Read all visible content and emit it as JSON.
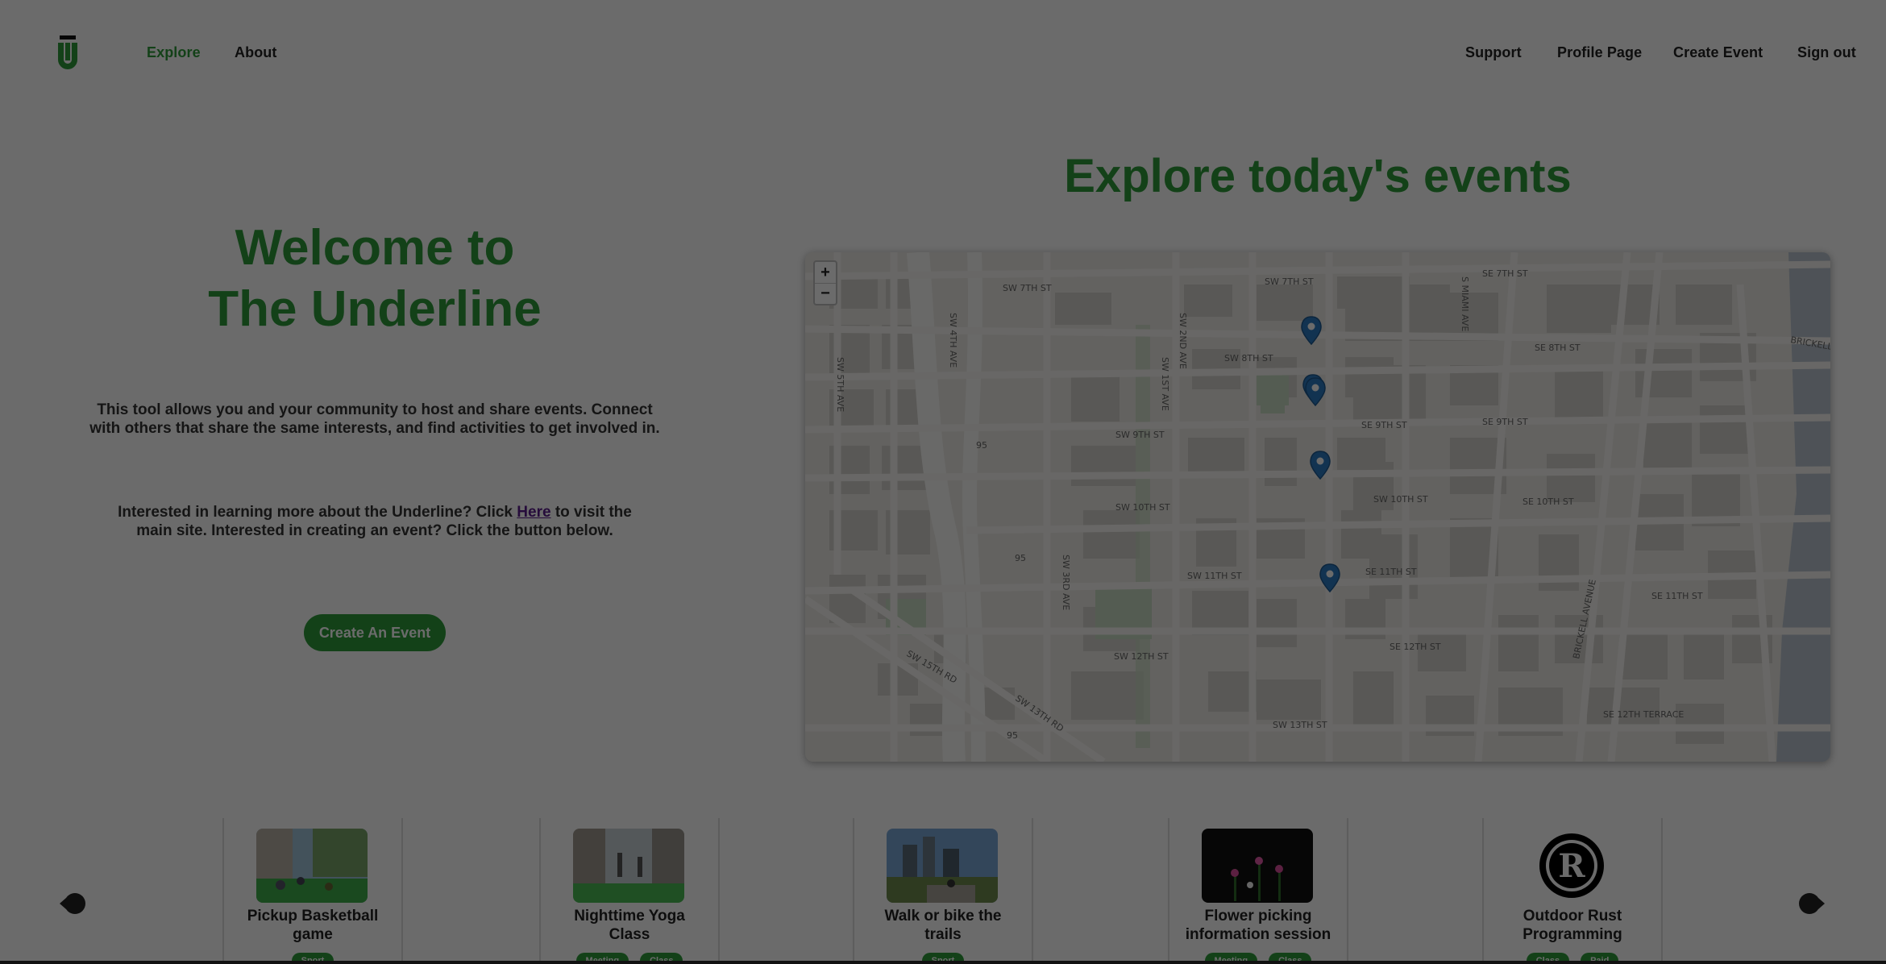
{
  "nav": {
    "left": [
      "Explore",
      "About"
    ],
    "right": [
      "Support",
      "Profile Page",
      "Create Event",
      "Sign out"
    ]
  },
  "hero": {
    "title_line1": "Welcome to",
    "title_line2": "The Underline",
    "description": "This tool allows you and your community to host and share events. Connect with others that share the same interests, and find activities to get involved in.",
    "learn_more_before": "Interested in learning more about the Underline? Click ",
    "learn_more_link": "Here",
    "learn_more_after": " to visit the main site. Interested in creating an event? Click the button below.",
    "cta_label": "Create An Event"
  },
  "explore": {
    "title": "Explore today's events",
    "zoom_in": "+",
    "zoom_out": "−",
    "street_labels": [
      "SW 7TH ST",
      "SW 7TH ST",
      "SE 7TH ST",
      "SW 8TH ST",
      "SE 8TH ST",
      "SW 9TH ST",
      "SE 9TH ST",
      "SE 9TH ST",
      "SW 10TH ST",
      "SW 10TH ST",
      "SE 10TH ST",
      "SW 11TH ST",
      "SE 11TH ST",
      "SE 11TH ST",
      "SW 12TH ST",
      "SE 12TH ST",
      "SW 13TH ST",
      "SE 12TH TERRACE",
      "SW 15TH RD",
      "SW 13TH RD",
      "SW 4TH AVE",
      "SW 2ND AVE",
      "S MIAMI AVE",
      "SW 3RD AVE",
      "BRICKELL AVENUE",
      "BRICKELL KEY",
      "SW 1ST AVE",
      "SW 5TH AVE",
      "95",
      "95",
      "95"
    ]
  },
  "events": [
    {
      "title_line1": "Pickup Basketball",
      "title_line2": "game",
      "tags": [
        "Sport"
      ]
    },
    {
      "title_line1": "Nighttime Yoga",
      "title_line2": "Class",
      "tags": [
        "Meeting",
        "Class"
      ]
    },
    {
      "title_line1": "Walk or bike the",
      "title_line2": "trails",
      "tags": [
        "Sport"
      ]
    },
    {
      "title_line1": "Flower picking",
      "title_line2": "information session",
      "tags": [
        "Meeting",
        "Class"
      ]
    },
    {
      "title_line1": "Outdoor Rust",
      "title_line2": "Programming",
      "tags": [
        "Class",
        "Paid"
      ]
    }
  ],
  "colors": {
    "brand_green": "#2e9c3b",
    "overlay": "rgba(0,0,0,0.58)",
    "marker_blue": "#2b7bc0"
  }
}
